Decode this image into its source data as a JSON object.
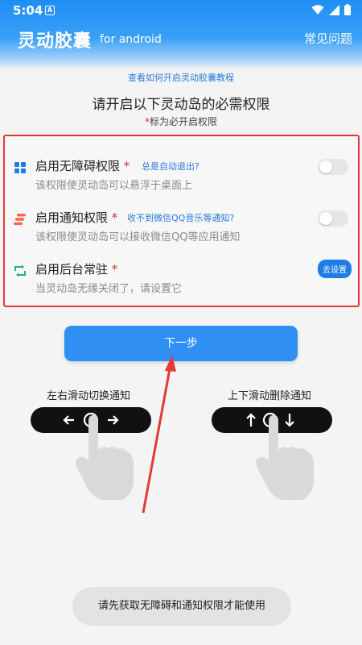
{
  "status_bar": {
    "time": "5:04",
    "notification_glyph": "A"
  },
  "header": {
    "title": "灵动胶囊",
    "subtitle": "for android",
    "faq_label": "常见问题"
  },
  "tutorial_link": "查看如何开启灵动胶囊教程",
  "heading": "请开启以下灵动岛的必需权限",
  "required_note": {
    "star": "*",
    "text": "标为必开启权限"
  },
  "permissions": [
    {
      "title": "启用无障碍权限",
      "star": "*",
      "hint": "总是自动退出?",
      "desc": "该权限使灵动岛可以悬浮于桌面上",
      "icon": "grid-icon",
      "control": "toggle",
      "enabled": false
    },
    {
      "title": "启用通知权限",
      "star": "*",
      "hint": "收不到微信QQ音乐等通知?",
      "desc": "该权限使灵动岛可以接收微信QQ等应用通知",
      "icon": "stack-icon",
      "control": "toggle",
      "enabled": false
    },
    {
      "title": "启用后台常驻",
      "star": "*",
      "hint": "",
      "desc": "当灵动岛无缘关闭了，请设置它",
      "icon": "refresh-icon",
      "control": "button",
      "button_label": "去设置"
    }
  ],
  "next_button": "下一步",
  "gestures": [
    {
      "label": "左右滑动切换通知",
      "icon": "left-right-arrows-icon"
    },
    {
      "label": "上下滑动删除通知",
      "icon": "up-down-arrows-icon"
    }
  ],
  "toast": "请先获取无障碍和通知权限才能使用",
  "colors": {
    "accent": "#2f8ff3",
    "link": "#2a7ad8",
    "highlight_border": "#e53935",
    "required_star": "#e02b2b"
  }
}
